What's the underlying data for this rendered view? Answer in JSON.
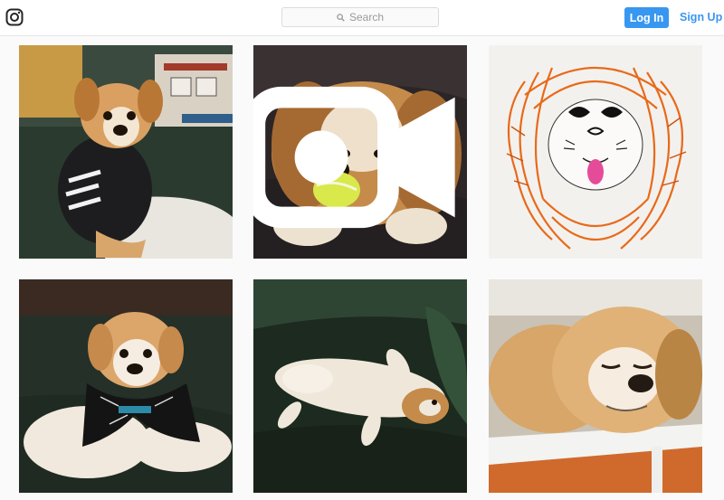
{
  "header": {
    "logo_icon": "instagram-camera-icon",
    "search_placeholder": "Search",
    "login_label": "Log In",
    "signup_label": "Sign Up",
    "accent_color": "#3897f0"
  },
  "posts": [
    {
      "name": "post-1",
      "subject": "dog-in-hoodie-on-sofa",
      "media": "photo"
    },
    {
      "name": "post-2",
      "subject": "dog-with-tennis-ball",
      "media": "video",
      "media_icon": "video-camera-icon"
    },
    {
      "name": "post-3",
      "subject": "dog-drawing",
      "media": "photo"
    },
    {
      "name": "post-4",
      "subject": "dog-with-bandana",
      "media": "photo"
    },
    {
      "name": "post-5",
      "subject": "dog-lying-on-back",
      "media": "photo"
    },
    {
      "name": "post-6",
      "subject": "sleepy-dog-on-chair",
      "media": "photo"
    }
  ]
}
